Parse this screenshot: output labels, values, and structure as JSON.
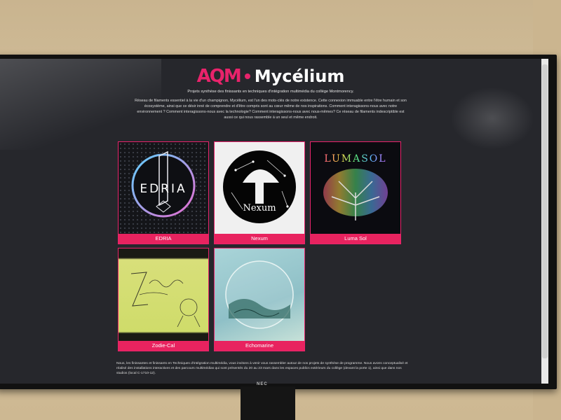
{
  "header": {
    "logo_text": "AQM",
    "title": "Mycélium",
    "subtitle": "Projets synthèse des finissants en techniques d'intégration multimédia du collège Montmorency.",
    "intro": "Réseau de filaments essentiel à la vie d'un champignon, Mycélium, est l'un des mots-clés de notre existence. Cette connexion immuable entre l'être humain et son écosystème, ainsi que ce désir inné de comprendre et d'être compris sont au cœur même de nos inspirations. Comment interagissons-nous avec notre environnement ? Comment interagissons-nous avec la technologie? Comment interagissons-nous avec nous-mêmes? Ce réseau de filaments indescriptible est aussi ce qui nous rassemble à un seul et même endroit."
  },
  "projects": [
    {
      "label": "EDRIA",
      "art_text": "EDRIA"
    },
    {
      "label": "Nexum",
      "art_text": "Nexum"
    },
    {
      "label": "Luma Sol",
      "art_text": "LUMASOL"
    },
    {
      "label": "Zodie-Cal",
      "art_text": ""
    },
    {
      "label": "Echomarine",
      "art_text": ""
    }
  ],
  "footer": {
    "text": "Nous, les finissantes et finissants en Techniques d'intégration multimédia, vous invitons à venir vous rassembler autour de nos projets de synthèse de programme. Nous avons conceptualisé et réalisé des installations interactives et des parcours multimédias qui sont présentés du 20 au 23 mars dans les espaces publics extérieurs du collège (devant la porte 1), ainsi que dans nos studios (local C-1710-12)."
  },
  "monitor": {
    "brand": "NEC"
  },
  "colors": {
    "accent": "#e8236b",
    "background": "#26272c"
  }
}
